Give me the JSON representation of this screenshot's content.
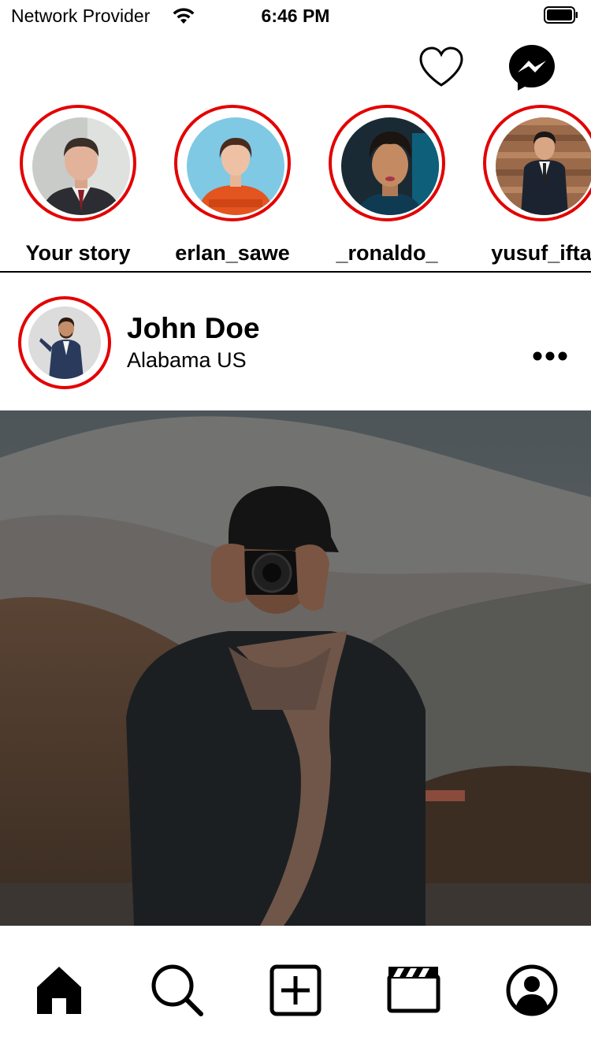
{
  "status_bar": {
    "carrier": "Network Provider",
    "time": "6:46 PM",
    "icons": [
      "wifi-icon",
      "battery-icon"
    ]
  },
  "top_bar": {
    "icons": [
      "heart-icon",
      "messenger-icon"
    ]
  },
  "stories": [
    {
      "username": "Your story"
    },
    {
      "username": "erlan_sawe"
    },
    {
      "username": "_ronaldo_"
    },
    {
      "username": "yusuf_ifta"
    }
  ],
  "post": {
    "author": "John Doe",
    "location": "Alabama US",
    "menu_icon": "more-horizontal-icon"
  },
  "tab_bar": {
    "tabs": [
      "home-icon",
      "search-icon",
      "add-post-icon",
      "reels-icon",
      "profile-icon"
    ],
    "active": "home-icon"
  },
  "colors": {
    "story_ring": "#e30000",
    "text": "#000000",
    "background": "#ffffff"
  }
}
